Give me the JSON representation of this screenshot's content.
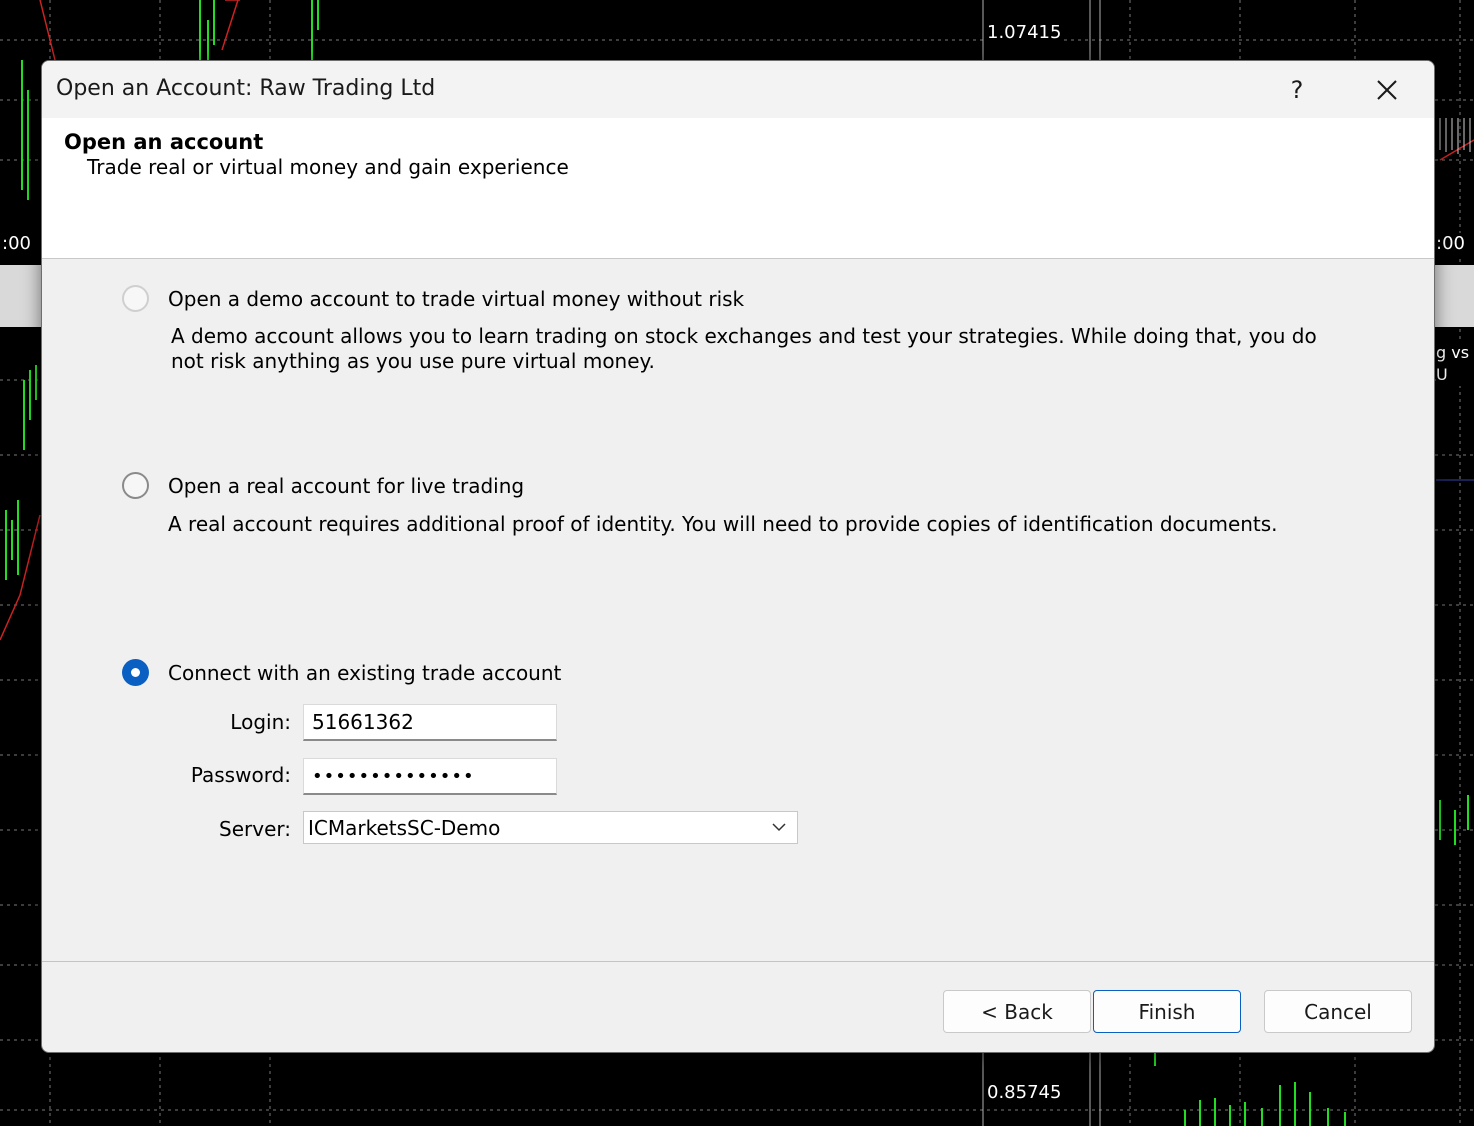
{
  "background": {
    "price_top": "1.07415",
    "price_bottom": "0.85745",
    "time_left": ":00",
    "time_right": ":00",
    "right_fragment": "g vs U"
  },
  "dialog": {
    "title": "Open an Account: Raw Trading Ltd",
    "help_label": "?",
    "close_label": "✕",
    "header_title": "Open an account",
    "header_subtitle": "Trade real or virtual money and gain experience",
    "options": {
      "demo": {
        "label": "Open a demo account to trade virtual money without risk",
        "desc": "A demo account allows you to learn trading on stock exchanges and test your strategies. While doing that, you do not risk anything as you use pure virtual money.",
        "checked": false,
        "enabled": false
      },
      "real": {
        "label": "Open a real account for live trading",
        "desc": "A real account requires additional proof of identity. You will need to provide copies of identification documents.",
        "checked": false,
        "enabled": true
      },
      "existing": {
        "label": "Connect with an existing trade account",
        "checked": true,
        "enabled": true
      }
    },
    "login": {
      "label": "Login:",
      "value": "51661362"
    },
    "password": {
      "label": "Password:",
      "value": "••••••••••••••"
    },
    "server": {
      "label": "Server:",
      "value": "ICMarketsSC-Demo"
    },
    "buttons": {
      "back": "< Back",
      "finish": "Finish",
      "cancel": "Cancel"
    },
    "accent_color": "#0a5fc2"
  }
}
